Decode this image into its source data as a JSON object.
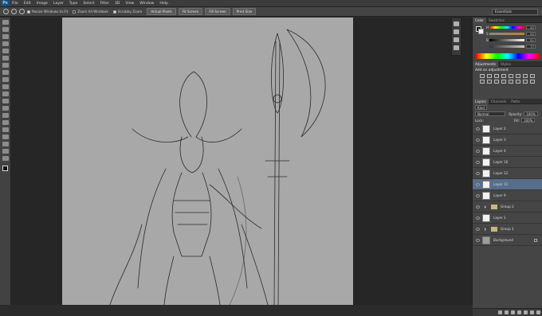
{
  "app": {
    "logo": "Ps"
  },
  "menu": [
    "File",
    "Edit",
    "Image",
    "Layer",
    "Type",
    "Select",
    "Filter",
    "3D",
    "View",
    "Window",
    "Help"
  ],
  "options": {
    "resize_windows": "Resize Windows to Fit",
    "zoom_all": "Zoom All Windows",
    "scrubby": "Scrubby Zoom",
    "actual_pixels": "Actual Pixels",
    "fit_screen": "Fit Screen",
    "fill_screen": "Fill Screen",
    "print_size": "Print Size"
  },
  "workspace": "Essentials",
  "color_panel": {
    "tabs": [
      "Color",
      "Swatches"
    ],
    "channels": [
      {
        "label": "H",
        "value": "42"
      },
      {
        "label": "S",
        "value": "52"
      },
      {
        "label": "B",
        "value": "51"
      },
      {
        "label": "",
        "value": "77"
      }
    ]
  },
  "adjustments": {
    "tabs": [
      "Adjustments",
      "Styles"
    ],
    "title": "Add an adjustment"
  },
  "layers": {
    "tabs": [
      "Layers",
      "Channels",
      "Paths"
    ],
    "filter": "Kind",
    "blend_mode": "Normal",
    "opacity_label": "Opacity:",
    "opacity": "100%",
    "lock_label": "Lock:",
    "fill_label": "Fill:",
    "fill": "100%",
    "items": [
      {
        "name": "Layer 2",
        "type": "layer",
        "selected": false
      },
      {
        "name": "Layer 3",
        "type": "layer",
        "selected": false
      },
      {
        "name": "Layer 4",
        "type": "layer",
        "selected": false
      },
      {
        "name": "Layer 10",
        "type": "layer",
        "selected": false
      },
      {
        "name": "Layer 12",
        "type": "layer",
        "selected": false
      },
      {
        "name": "Layer 11",
        "type": "layer",
        "selected": true
      },
      {
        "name": "Layer 9",
        "type": "layer",
        "selected": false
      },
      {
        "name": "Group 2",
        "type": "group",
        "selected": false
      },
      {
        "name": "Layer 1",
        "type": "layer",
        "selected": false
      },
      {
        "name": "Group 1",
        "type": "group",
        "selected": false
      },
      {
        "name": "Background",
        "type": "background",
        "selected": false
      }
    ]
  },
  "colors": {
    "selection": "#566e8c",
    "canvas": "#a8a8a8",
    "sketch": "#2a2a2a"
  }
}
